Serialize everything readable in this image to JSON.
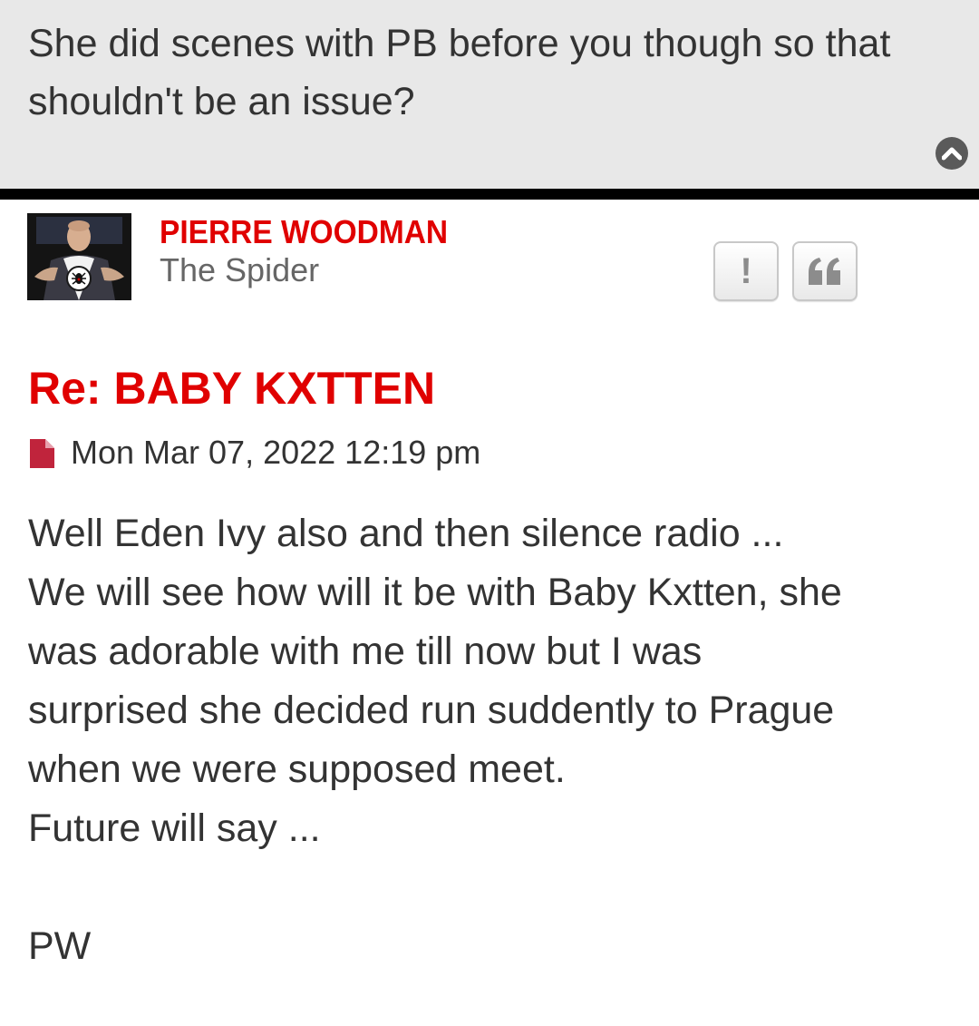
{
  "previous_post": {
    "text": "She did scenes with PB before you though so that shouldn't be an issue?"
  },
  "post": {
    "author": "PIERRE WOODMAN",
    "rank": "The Spider",
    "title": "Re: BABY KXTTEN",
    "date": "Mon Mar 07, 2022 12:19 pm",
    "body_lines": [
      "Well Eden Ivy also and then silence radio ...",
      "We will see how will it be with Baby Kxtten, she",
      "was adorable with me till now but I was",
      "surprised she decided run suddently to Prague",
      "when we were supposed meet.",
      "Future will say ...",
      "",
      "PW"
    ],
    "buttons": {
      "report_icon": "exclamation-icon",
      "quote_icon": "quote-icon"
    }
  },
  "colors": {
    "accent_red": "#e00000",
    "text": "#333333",
    "quote_bg": "#e8e8e8",
    "divider": "#000000",
    "post_icon": "#c0243c"
  }
}
